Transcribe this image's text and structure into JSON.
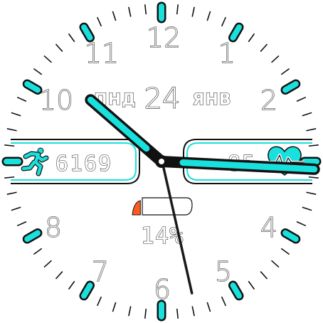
{
  "watch_face": {
    "numerals": [
      "12",
      "1",
      "2",
      "4",
      "5",
      "6",
      "7",
      "8",
      "10",
      "11"
    ],
    "date": {
      "weekday": "ПНД",
      "day": "24",
      "month": "ЯНВ"
    },
    "steps": {
      "value": "6169",
      "icon": "running-person-icon"
    },
    "heart_rate": {
      "value": "85",
      "icon": "heart-pulse-icon"
    },
    "battery": {
      "percent_label": "14%",
      "level": 0.14
    },
    "time": {
      "hour": 3,
      "minute": 52,
      "second": 29
    },
    "colors": {
      "accent": "#19e0dc",
      "hand_outline": "#111111",
      "second_hand": "#1a1a1a",
      "battery_low": "#ff5a1f",
      "tick": "#111111"
    }
  }
}
